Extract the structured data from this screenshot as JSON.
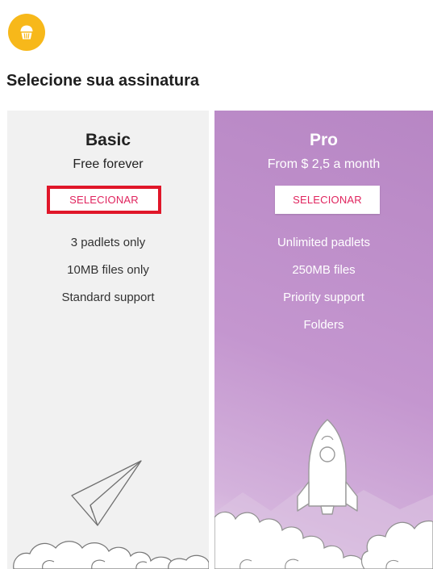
{
  "header": {
    "logo_icon": "muffin-icon",
    "logo_color": "#f7b81a",
    "title": "Selecione sua assinatura"
  },
  "plans": [
    {
      "name": "Basic",
      "price": "Free forever",
      "select_label": "SELECIONAR",
      "features": [
        "3 padlets only",
        "10MB files only",
        "Standard support"
      ],
      "illustration": "paper-plane-icon",
      "highlighted": true
    },
    {
      "name": "Pro",
      "price": "From $ 2,5 a month",
      "select_label": "SELECIONAR",
      "features": [
        "Unlimited padlets",
        "250MB files",
        "Priority support",
        "Folders"
      ],
      "illustration": "rocket-icon",
      "highlighted": false
    }
  ],
  "colors": {
    "accent": "#e0245e",
    "highlight_border": "#e01629",
    "pro_background": "#c496cf",
    "basic_background": "#f1f1f1"
  }
}
